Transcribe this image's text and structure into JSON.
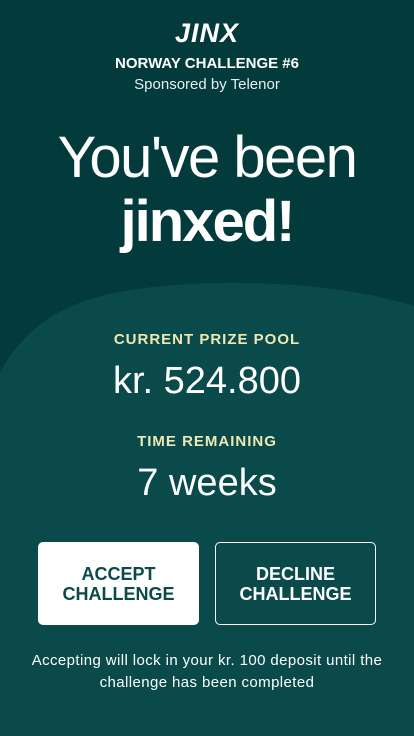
{
  "header": {
    "logo": "JINX",
    "challenge_title": "NORWAY CHALLENGE #6",
    "sponsor": "Sponsored by Telenor"
  },
  "headline": {
    "line1": "You've been",
    "line2": "jinxed!"
  },
  "prize": {
    "label": "CURRENT PRIZE POOL",
    "value": "kr. 524.800"
  },
  "time": {
    "label": "TIME REMAINING",
    "value": "7 weeks"
  },
  "actions": {
    "accept_label": "ACCEPT CHALLENGE",
    "decline_label": "DECLINE CHALLENGE"
  },
  "notice": "Accepting will lock in your kr. 100 deposit until the challenge has been completed",
  "colors": {
    "background_top": "#033a3c",
    "background_bottom": "#0a4a4b",
    "accent_label": "#eee8b4",
    "button_text": "#0a4a4b"
  }
}
